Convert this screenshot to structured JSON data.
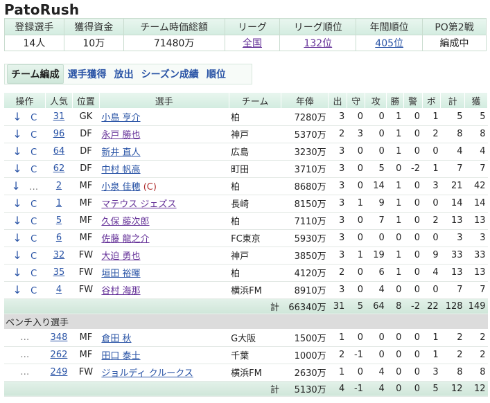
{
  "title": "PatoRush",
  "summary": {
    "headers": [
      "登録選手",
      "獲得資金",
      "チーム時価総額",
      "リーグ",
      "リーグ順位",
      "年間順位",
      "PO第2戦"
    ],
    "values": [
      "14人",
      "10万",
      "71480万",
      "全国",
      "132位",
      "405位",
      "編成中"
    ]
  },
  "tabs": [
    "チーム編成",
    "選手獲得",
    "放出",
    "シーズン成績",
    "順位"
  ],
  "table": {
    "headers": [
      "操作",
      "人気",
      "位置",
      "選手",
      "チーム",
      "年俸",
      "出",
      "守",
      "攻",
      "勝",
      "警",
      "ボ",
      "計",
      "獲"
    ],
    "down_symbol": "↓",
    "c_symbol": "C",
    "dots_symbol": "…",
    "starters": [
      {
        "pop": "31",
        "pos": "GK",
        "name": "小島 亨介",
        "name_color": "blue",
        "captain": "",
        "team": "柏",
        "salary": "7280万",
        "stats": [
          "3",
          "0",
          "0",
          "1",
          "0",
          "1",
          "5",
          "5"
        ],
        "op": "dc"
      },
      {
        "pop": "96",
        "pos": "DF",
        "name": "永戸 勝也",
        "name_color": "purple",
        "captain": "",
        "team": "神戸",
        "salary": "5370万",
        "stats": [
          "2",
          "3",
          "0",
          "1",
          "0",
          "2",
          "8",
          "8"
        ],
        "op": "dc"
      },
      {
        "pop": "64",
        "pos": "DF",
        "name": "新井 直人",
        "name_color": "blue",
        "captain": "",
        "team": "広島",
        "salary": "3230万",
        "stats": [
          "3",
          "0",
          "0",
          "1",
          "0",
          "0",
          "4",
          "4"
        ],
        "op": "dc"
      },
      {
        "pop": "62",
        "pos": "DF",
        "name": "中村 帆高",
        "name_color": "blue",
        "captain": "",
        "team": "町田",
        "salary": "3710万",
        "stats": [
          "3",
          "0",
          "5",
          "0",
          "-2",
          "1",
          "7",
          "7"
        ],
        "op": "dc"
      },
      {
        "pop": "2",
        "pos": "MF",
        "name": "小泉 佳穂",
        "name_color": "blue",
        "captain": "(C)",
        "team": "柏",
        "salary": "8680万",
        "stats": [
          "3",
          "0",
          "14",
          "1",
          "0",
          "3",
          "21",
          "42"
        ],
        "op": "dd"
      },
      {
        "pop": "1",
        "pos": "MF",
        "name": "マテウス ジェズス",
        "name_color": "purple",
        "captain": "",
        "team": "長崎",
        "salary": "8150万",
        "stats": [
          "3",
          "1",
          "9",
          "1",
          "0",
          "0",
          "14",
          "14"
        ],
        "op": "dc"
      },
      {
        "pop": "5",
        "pos": "MF",
        "name": "久保 藤次郎",
        "name_color": "purple",
        "captain": "",
        "team": "柏",
        "salary": "7110万",
        "stats": [
          "3",
          "0",
          "7",
          "1",
          "0",
          "2",
          "13",
          "13"
        ],
        "op": "dc"
      },
      {
        "pop": "6",
        "pos": "MF",
        "name": "佐藤 龍之介",
        "name_color": "purple",
        "captain": "",
        "team": "FC東京",
        "salary": "5930万",
        "stats": [
          "3",
          "0",
          "0",
          "0",
          "0",
          "0",
          "3",
          "3"
        ],
        "op": "dc"
      },
      {
        "pop": "32",
        "pos": "FW",
        "name": "大迫 勇也",
        "name_color": "purple",
        "captain": "",
        "team": "神戸",
        "salary": "3850万",
        "stats": [
          "3",
          "1",
          "19",
          "1",
          "0",
          "9",
          "33",
          "33"
        ],
        "op": "dc"
      },
      {
        "pop": "35",
        "pos": "FW",
        "name": "垣田 裕暉",
        "name_color": "blue",
        "captain": "",
        "team": "柏",
        "salary": "4120万",
        "stats": [
          "2",
          "0",
          "6",
          "1",
          "0",
          "4",
          "13",
          "13"
        ],
        "op": "dc"
      },
      {
        "pop": "4",
        "pos": "FW",
        "name": "谷村 海那",
        "name_color": "purple",
        "captain": "",
        "team": "横浜FM",
        "salary": "8910万",
        "stats": [
          "3",
          "0",
          "4",
          "0",
          "0",
          "0",
          "7",
          "7"
        ],
        "op": "dc"
      }
    ],
    "starters_total": {
      "label": "計",
      "salary": "66340万",
      "stats": [
        "31",
        "5",
        "64",
        "8",
        "-2",
        "22",
        "128",
        "149"
      ]
    },
    "bench_label": "ベンチ入り選手",
    "bench": [
      {
        "pop": "348",
        "pos": "MF",
        "name": "倉田 秋",
        "name_color": "blue",
        "team": "G大阪",
        "salary": "1500万",
        "stats": [
          "1",
          "0",
          "0",
          "0",
          "0",
          "1",
          "2",
          "2"
        ]
      },
      {
        "pop": "262",
        "pos": "MF",
        "name": "田口 泰士",
        "name_color": "blue",
        "team": "千葉",
        "salary": "1000万",
        "stats": [
          "2",
          "-1",
          "0",
          "0",
          "0",
          "1",
          "2",
          "2"
        ]
      },
      {
        "pop": "249",
        "pos": "FW",
        "name": "ジョルディ クルークス",
        "name_color": "blue",
        "team": "横浜FM",
        "salary": "2630万",
        "stats": [
          "1",
          "0",
          "4",
          "0",
          "0",
          "3",
          "8",
          "8"
        ]
      }
    ],
    "bench_total": {
      "label": "計",
      "salary": "5130万",
      "stats": [
        "4",
        "-1",
        "4",
        "0",
        "0",
        "5",
        "12",
        "12"
      ]
    }
  }
}
